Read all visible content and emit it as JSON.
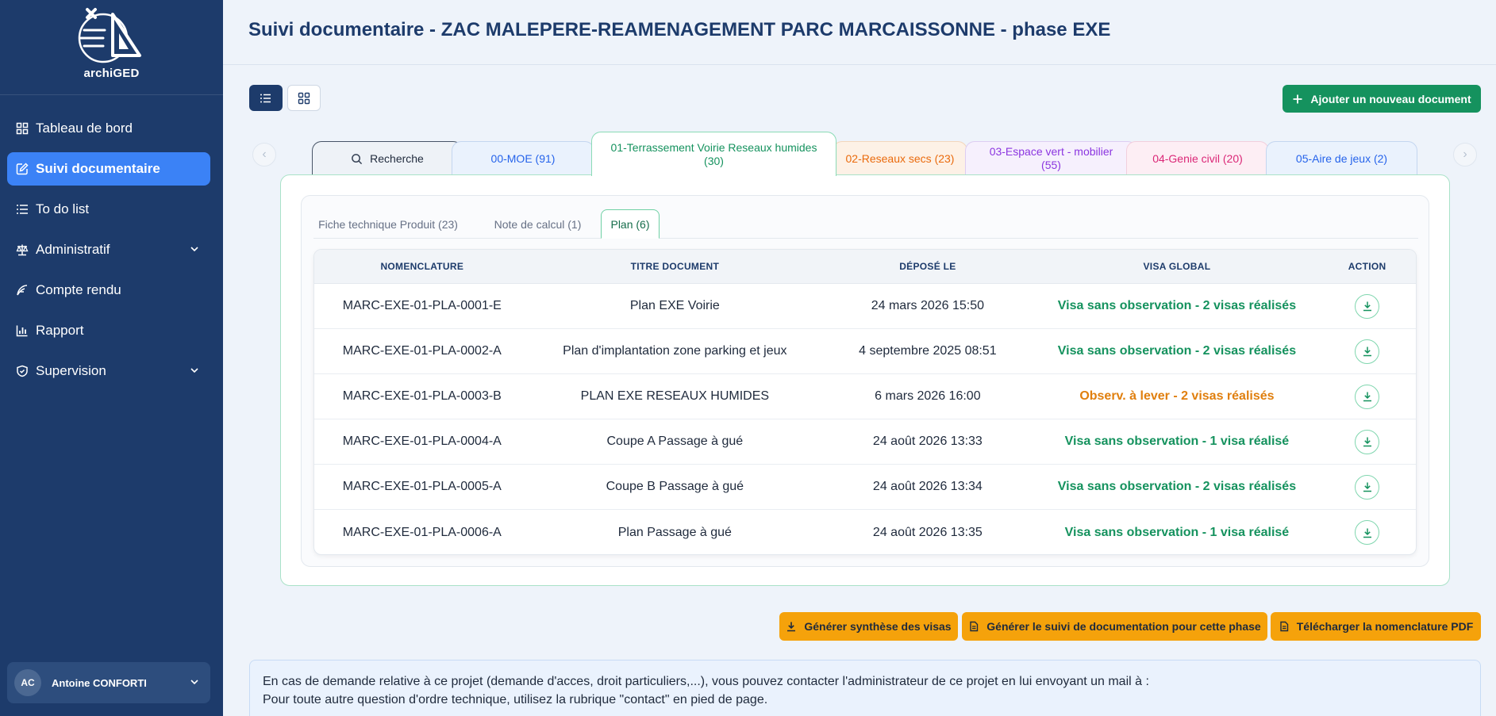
{
  "app": {
    "logo_text": "archiGED"
  },
  "sidebar": {
    "items": [
      {
        "label": "Tableau de bord",
        "icon": "dashboard-icon",
        "active": false
      },
      {
        "label": "Suivi documentaire",
        "icon": "edit-document-icon",
        "active": true
      },
      {
        "label": "To do list",
        "icon": "list-icon",
        "active": false
      },
      {
        "label": "Administratif",
        "icon": "scale-icon",
        "active": false,
        "expandable": true
      },
      {
        "label": "Compte rendu",
        "icon": "pen-icon",
        "active": false
      },
      {
        "label": "Rapport",
        "icon": "bar-chart-icon",
        "active": false
      },
      {
        "label": "Supervision",
        "icon": "shield-icon",
        "active": false,
        "expandable": true
      }
    ],
    "user": {
      "initials": "AC",
      "name": "Antoine CONFORTI"
    }
  },
  "header": {
    "title": "Suivi documentaire - ZAC MALEPERE-REAMENAGEMENT PARC MARCAISSONNE - phase EXE"
  },
  "toolbar": {
    "add_label": "Ajouter un nouveau document"
  },
  "tabs": [
    {
      "label": "Recherche",
      "icon": "search-icon"
    },
    {
      "label": "00-MOE (91)",
      "color": "#2563eb"
    },
    {
      "label": "01-Terrassement Voirie Reseaux humides (30)",
      "color": "#15925e",
      "active": true
    },
    {
      "label": "02-Reseaux secs (23)",
      "color": "#ea6a0c"
    },
    {
      "label": "03-Espace vert - mobilier (55)",
      "color": "#8b35e0"
    },
    {
      "label": "04-Genie civil (20)",
      "color": "#db2777"
    },
    {
      "label": "05-Aire de jeux (2)",
      "color": "#2563eb"
    }
  ],
  "subtabs": [
    {
      "label": "Fiche technique Produit (23)"
    },
    {
      "label": "Note de calcul (1)"
    },
    {
      "label": "Plan (6)",
      "active": true
    }
  ],
  "table": {
    "headers": [
      "NOMENCLATURE",
      "TITRE DOCUMENT",
      "DÉPOSÉ LE",
      "VISA GLOBAL",
      "ACTION"
    ],
    "rows": [
      {
        "nomenclature": "MARC-EXE-01-PLA-0001-E",
        "titre": "Plan EXE Voirie",
        "depose": "24 mars 2026 15:50",
        "visa": "Visa sans observation - 2 visas réalisés",
        "visa_color": "#15925e"
      },
      {
        "nomenclature": "MARC-EXE-01-PLA-0002-A",
        "titre": "Plan d'implantation zone parking et jeux",
        "depose": "4 septembre 2025 08:51",
        "visa": "Visa sans observation - 2 visas réalisés",
        "visa_color": "#15925e"
      },
      {
        "nomenclature": "MARC-EXE-01-PLA-0003-B",
        "titre": "PLAN EXE RESEAUX HUMIDES",
        "depose": "6 mars 2026 16:00",
        "visa": "Observ. à lever - 2 visas réalisés",
        "visa_color": "#e07f0e"
      },
      {
        "nomenclature": "MARC-EXE-01-PLA-0004-A",
        "titre": "Coupe A Passage à gué",
        "depose": "24 août 2026 13:33",
        "visa": "Visa sans observation - 1 visa réalisé",
        "visa_color": "#15925e"
      },
      {
        "nomenclature": "MARC-EXE-01-PLA-0005-A",
        "titre": "Coupe B Passage à gué",
        "depose": "24 août 2026 13:34",
        "visa": "Visa sans observation - 2 visas réalisés",
        "visa_color": "#15925e"
      },
      {
        "nomenclature": "MARC-EXE-01-PLA-0006-A",
        "titre": "Plan Passage à gué",
        "depose": "24 août 2026 13:35",
        "visa": "Visa sans observation - 1 visa réalisé",
        "visa_color": "#15925e"
      }
    ]
  },
  "actions": {
    "synthese": "Générer synthèse des visas",
    "suivi": "Générer le suivi de documentation pour cette phase",
    "nomenclature": "Télécharger la nomenclature PDF"
  },
  "info": {
    "line1": "En cas de demande relative à ce projet (demande d'acces, droit particuliers,...), vous pouvez contacter l'administrateur de ce projet en lui envoyant un mail à :",
    "line2": "Pour toute autre question d'ordre technique, utilisez la rubrique \"contact\" en pied de page."
  },
  "colors": {
    "sidebar": "#1d3b6b",
    "accent": "#3b82f6",
    "success": "#15925e",
    "warning": "#f5a20b"
  }
}
